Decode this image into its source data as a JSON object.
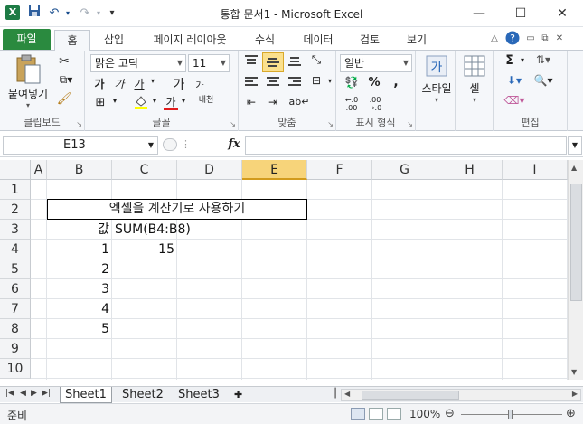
{
  "window": {
    "title": "통합 문서1 - Microsoft Excel",
    "app_icon_letter": "X"
  },
  "ribbon_tabs": {
    "file": "파일",
    "home": "홈",
    "insert": "삽입",
    "page_layout": "페이지 레이아웃",
    "formulas": "수식",
    "data": "데이터",
    "review": "검토",
    "view": "보기"
  },
  "ribbon": {
    "clipboard": {
      "paste": "붙여넣기",
      "label": "클립보드"
    },
    "font": {
      "name": "맑은 고딕",
      "size": "11",
      "bold": "가",
      "italic": "가",
      "underline": "가",
      "grow": "가",
      "shrink": "가",
      "phonetic": "내천",
      "label": "글꼴"
    },
    "alignment": {
      "label": "맞춤"
    },
    "number": {
      "format": "일반",
      "label": "표시 형식"
    },
    "styles": {
      "label": "스타일"
    },
    "cells": {
      "label": "셀"
    },
    "editing": {
      "label": "편집",
      "sum": "Σ"
    }
  },
  "formula_bar": {
    "name_box": "E13",
    "fx": "fx",
    "value": ""
  },
  "columns": [
    "A",
    "B",
    "C",
    "D",
    "E",
    "F",
    "G",
    "H",
    "I"
  ],
  "rows": [
    "1",
    "2",
    "3",
    "4",
    "5",
    "6",
    "7",
    "8",
    "9",
    "10"
  ],
  "cells": {
    "title": "엑셀을 계산기로 사용하기",
    "b3": "값",
    "c3": "SUM(B4:B8)",
    "b4": "1",
    "c4": "15",
    "b5": "2",
    "b6": "3",
    "b7": "4",
    "b8": "5"
  },
  "sheets": [
    "Sheet1",
    "Sheet2",
    "Sheet3"
  ],
  "status": {
    "ready": "준비",
    "zoom": "100%"
  },
  "colors": {
    "file_tab": "#2a8a3f",
    "selected_column": "#f7d47a",
    "accent": "#1b4f8f"
  }
}
